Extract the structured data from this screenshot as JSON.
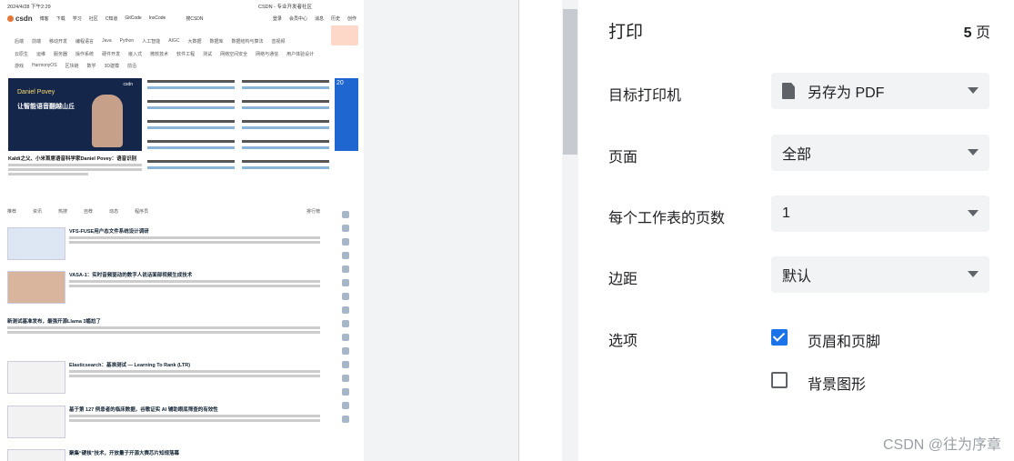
{
  "preview": {
    "header_left": "2024/4/28 下午2:29",
    "header_center": "CSDN - 专业开发者社区",
    "logo": "csdn",
    "topnav": [
      "博客",
      "下载",
      "学习",
      "社区",
      "C知道",
      "GitCode",
      "InsCode"
    ],
    "search": "搜CSDN",
    "topnav_right": [
      "登录",
      "会员中心",
      "消息",
      "历史",
      "创作"
    ],
    "tags_row1": [
      "后端",
      "前端",
      "移动开发",
      "编程语言",
      "Java",
      "Python",
      "人工智能",
      "AIGC",
      "大数据",
      "数据库",
      "数据结构与算法",
      "音视频"
    ],
    "tags_row2": [
      "云原生",
      "运维",
      "服务器",
      "操作系统",
      "硬件开发",
      "嵌入式",
      "微软技术",
      "软件工程",
      "测试",
      "网络空间安全",
      "网络与通信",
      "用户体验设计"
    ],
    "tags_row3": [
      "游戏",
      "HarmonyOS",
      "区块链",
      "数学",
      "3D建模",
      "前沿"
    ],
    "hero": {
      "brand": "csdn",
      "name": "Daniel Povey",
      "tag": "让智能语音翻越山丘"
    },
    "hero_title": "Kaldi之父、小米首席语音科学家Daniel Povey：语音识别",
    "tabs": [
      "推荐",
      "资讯",
      "热搜",
      "自荐",
      "动态",
      "程序员"
    ],
    "tabs_right": "排行榜",
    "feed": [
      {
        "title": "VFS-FUSE用户态文件系统设计调研"
      },
      {
        "title": "VASA-1：实时音频驱动的数字人说话面部视频生成技术"
      },
      {
        "title": "新测试基准发布，最强开源Llama 3尴尬了"
      },
      {
        "title": "Elasticsearch：基准测试 — Learning To Rank (LTR)"
      },
      {
        "title": "基于第 127 例患者的临床数据，谷歌证实 AI 辅助眼底筛查的有效性"
      },
      {
        "title": "聚集“硬核”技术，开放量子开源大赛芯片知规落幕"
      }
    ],
    "side_text": "20"
  },
  "panel": {
    "title": "打印",
    "pages_count": "5",
    "pages_unit": "页",
    "rows": [
      {
        "label": "目标打印机",
        "value": "另存为 PDF"
      },
      {
        "label": "页面",
        "value": "全部"
      },
      {
        "label": "每个工作表的页数",
        "value": "1"
      },
      {
        "label": "边距",
        "value": "默认"
      }
    ],
    "options_label": "选项",
    "checkbox1": "页眉和页脚",
    "checkbox2": "背景图形",
    "watermark": "CSDN @往为序章"
  }
}
